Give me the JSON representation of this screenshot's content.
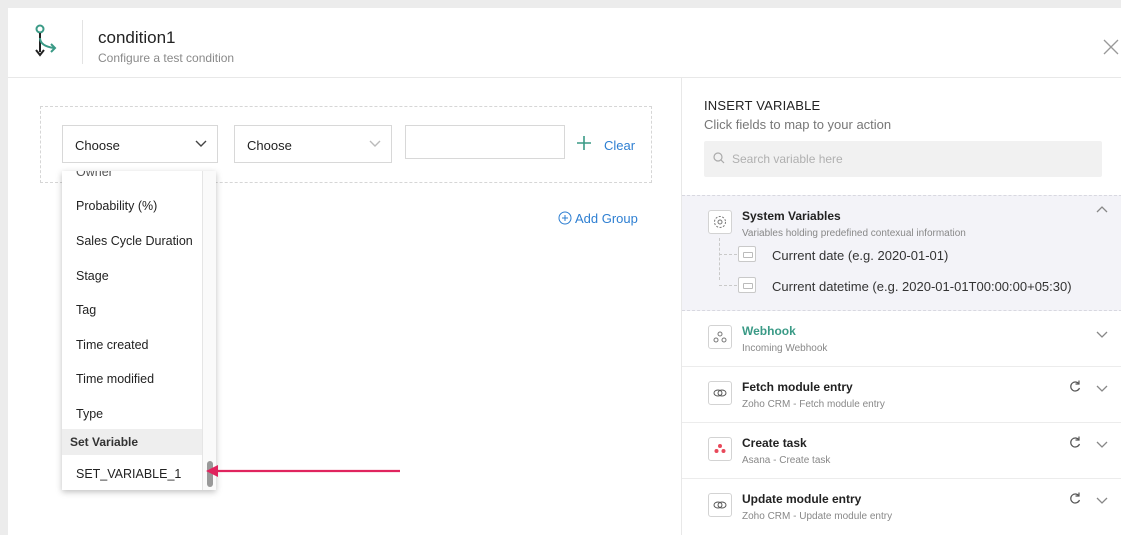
{
  "header": {
    "title": "condition1",
    "subtitle": "Configure a test condition"
  },
  "condition": {
    "field_select": "Choose",
    "operator_select": "Choose",
    "value": "",
    "clear_label": "Clear",
    "add_group_label": "Add Group"
  },
  "dropdown": {
    "partial_item": "Owner",
    "items": [
      "Probability (%)",
      "Sales Cycle Duration",
      "Stage",
      "Tag",
      "Time created",
      "Time modified",
      "Type"
    ],
    "group_label": "Set Variable",
    "group_items": [
      "SET_VARIABLE_1"
    ]
  },
  "insert_variable": {
    "title": "INSERT VARIABLE",
    "subtitle": "Click fields to map to your action",
    "search_placeholder": "Search variable here",
    "system": {
      "title": "System Variables",
      "subtitle": "Variables holding predefined contexual information",
      "items": [
        "Current date (e.g. 2020-01-01)",
        "Current datetime (e.g. 2020-01-01T00:00:00+05:30)"
      ]
    },
    "sources": [
      {
        "title": "Webhook",
        "subtitle": "Incoming Webhook",
        "icon": "webhook-icon",
        "color": "#3a9a86"
      },
      {
        "title": "Fetch module entry",
        "subtitle": "Zoho CRM - Fetch module entry",
        "icon": "zoho-crm-icon"
      },
      {
        "title": "Create task",
        "subtitle": "Asana - Create task",
        "icon": "asana-icon"
      },
      {
        "title": "Update module entry",
        "subtitle": "Zoho CRM - Update module entry",
        "icon": "zoho-crm-icon"
      }
    ]
  },
  "colors": {
    "accent": "#2e7fd2",
    "arrow": "#e0245e",
    "webhook": "#3a9a86",
    "logo": "#3a9a86"
  }
}
